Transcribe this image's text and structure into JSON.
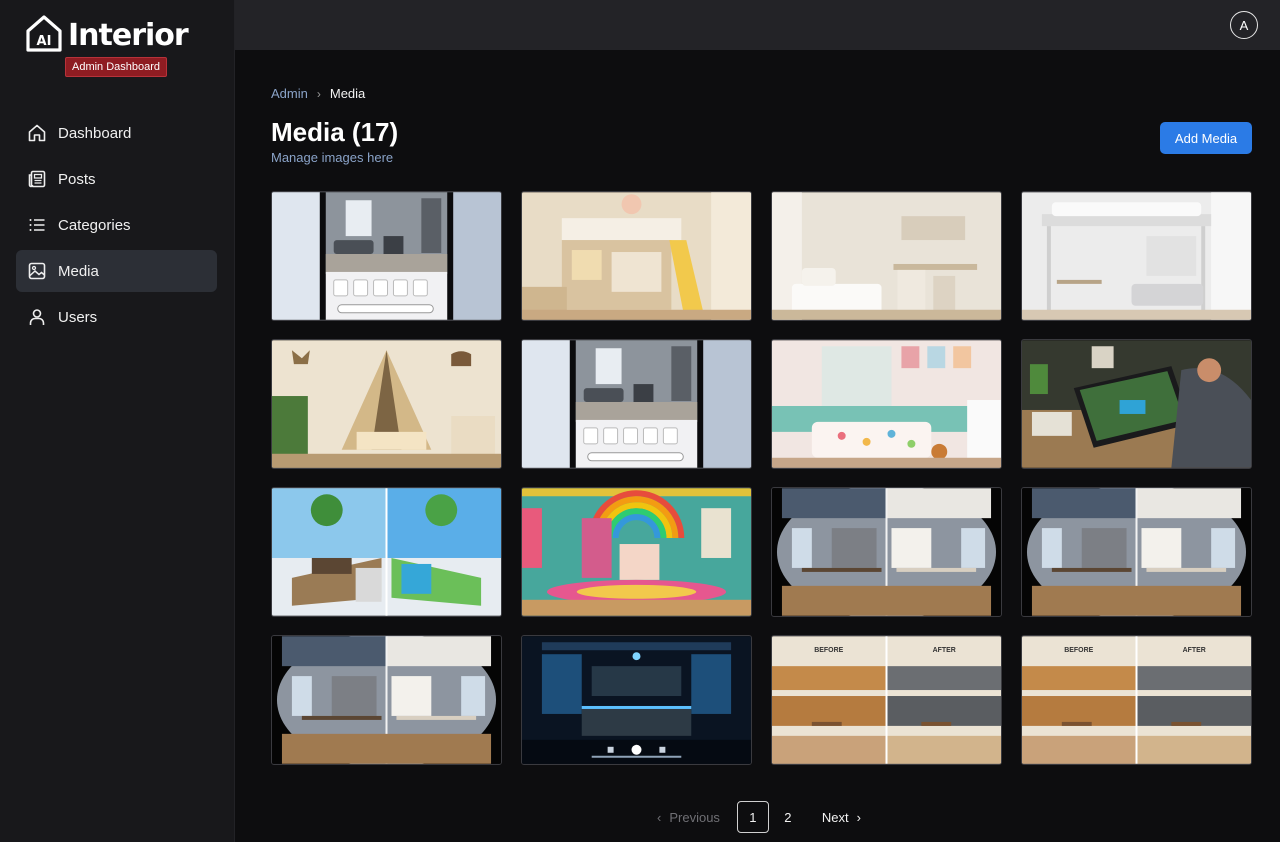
{
  "app": {
    "logo_mark": "AI",
    "logo_text": "Interior",
    "badge": "Admin Dashboard"
  },
  "sidebar": {
    "items": [
      {
        "label": "Dashboard",
        "icon": "home-icon",
        "active": false
      },
      {
        "label": "Posts",
        "icon": "newspaper-icon",
        "active": false
      },
      {
        "label": "Categories",
        "icon": "list-icon",
        "active": false
      },
      {
        "label": "Media",
        "icon": "image-icon",
        "active": true
      },
      {
        "label": "Users",
        "icon": "user-icon",
        "active": false
      }
    ]
  },
  "header": {
    "avatar_initial": "A"
  },
  "breadcrumb": {
    "root": "Admin",
    "current": "Media"
  },
  "page": {
    "title": "Media (17)",
    "subtitle": "Manage images here",
    "add_button": "Add Media"
  },
  "media": [
    {
      "name": "phone-app-living-room"
    },
    {
      "name": "kids-loft-bed-slide"
    },
    {
      "name": "neutral-bedroom-desk"
    },
    {
      "name": "white-loft-bed-study"
    },
    {
      "name": "safari-tent-kids-room"
    },
    {
      "name": "phone-app-living-room"
    },
    {
      "name": "pastel-kids-bedroom"
    },
    {
      "name": "tablet-pool-design"
    },
    {
      "name": "garden-before-after"
    },
    {
      "name": "rainbow-playroom"
    },
    {
      "name": "kitchen-before-after"
    },
    {
      "name": "kitchen-before-after"
    },
    {
      "name": "kitchen-before-after"
    },
    {
      "name": "futuristic-kitchen-video"
    },
    {
      "name": "kitchen-before-after-labeled",
      "labels": [
        "BEFORE",
        "AFTER"
      ]
    },
    {
      "name": "kitchen-before-after-labeled",
      "labels": [
        "BEFORE",
        "AFTER"
      ]
    }
  ],
  "pagination": {
    "previous": "Previous",
    "pages": [
      "1",
      "2"
    ],
    "current": "1",
    "next": "Next"
  },
  "colors": {
    "accent": "#2b7be6",
    "badge": "#8e1c22",
    "link": "#8aa3c8",
    "active_nav": "#2c2f36"
  }
}
